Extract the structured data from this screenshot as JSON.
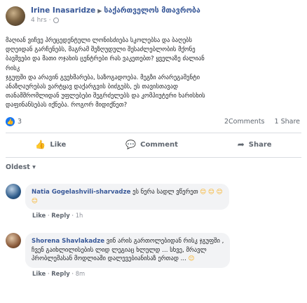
{
  "post": {
    "author": "Irine Inasaridze",
    "group": "საქართველოს მთავრობა",
    "time": "4 hrs",
    "body_lines": [
      "მაღიან ვიჩვე პრეცედენტული ლონისძიება სკოლებსა და ბაღებს",
      "დღეიდან გარჩენებს, მაგრამ შეზღუდული შესაძლებლობის მქონე",
      "ბავშვები და მათი ოჯახის ცენტრები რას ვაკეთებთ? ყველაზე ძალიან რისკ",
      "ჯგუფში და არავინ გვეხმარება, საზოგადოება. მეგზი არარეგამენტი",
      "ანაზღაურებას ვარტყავ დაქარგვის ბიძგებს, ეს თავისთავად",
      "თანამშრომლიდან უფლებები შეგრძელებს და კომპიუტერი ხარისხის",
      "დაფინანსებას იქნება. როგორ მიდიქნეთ?"
    ]
  },
  "reactions": {
    "count": "3",
    "comments": "2Comments",
    "shares": "1 Share"
  },
  "actions": {
    "like": "Like",
    "like_icon": "thumbs-up-icon",
    "comment": "Comment",
    "comment_icon": "speech-bubble-icon",
    "share": "Share",
    "share_icon": "share-arrow-icon"
  },
  "sort_label": "Oldest ▾",
  "comments": [
    {
      "name": "Natia Gogelashvili-sharvadze",
      "text_line1": "ეს ნერა სადლ ვწერეთ",
      "emoji1": "😊 😊 😊",
      "emoji2": "😊",
      "like": "Like",
      "reply": "Reply",
      "time": "1h",
      "avatar_color": "#2d5b8a"
    },
    {
      "name": "Shorena Shavlakadze",
      "text_line1": "ვინ არის გართოლებიდან რისკ ჯგუფში ,",
      "text_line2": "ჩვენ გაიხლილისების ლიდ ლეგიაც ხლულდ ... სხვე, მრავლ",
      "text_line3": "პრობლემასან მოდლიაში დალევებიანისაზ ერთად ...",
      "emoji": "😊",
      "like": "Like",
      "reply": "Reply",
      "time": "8m",
      "avatar_color": "#8a5a3a"
    }
  ]
}
